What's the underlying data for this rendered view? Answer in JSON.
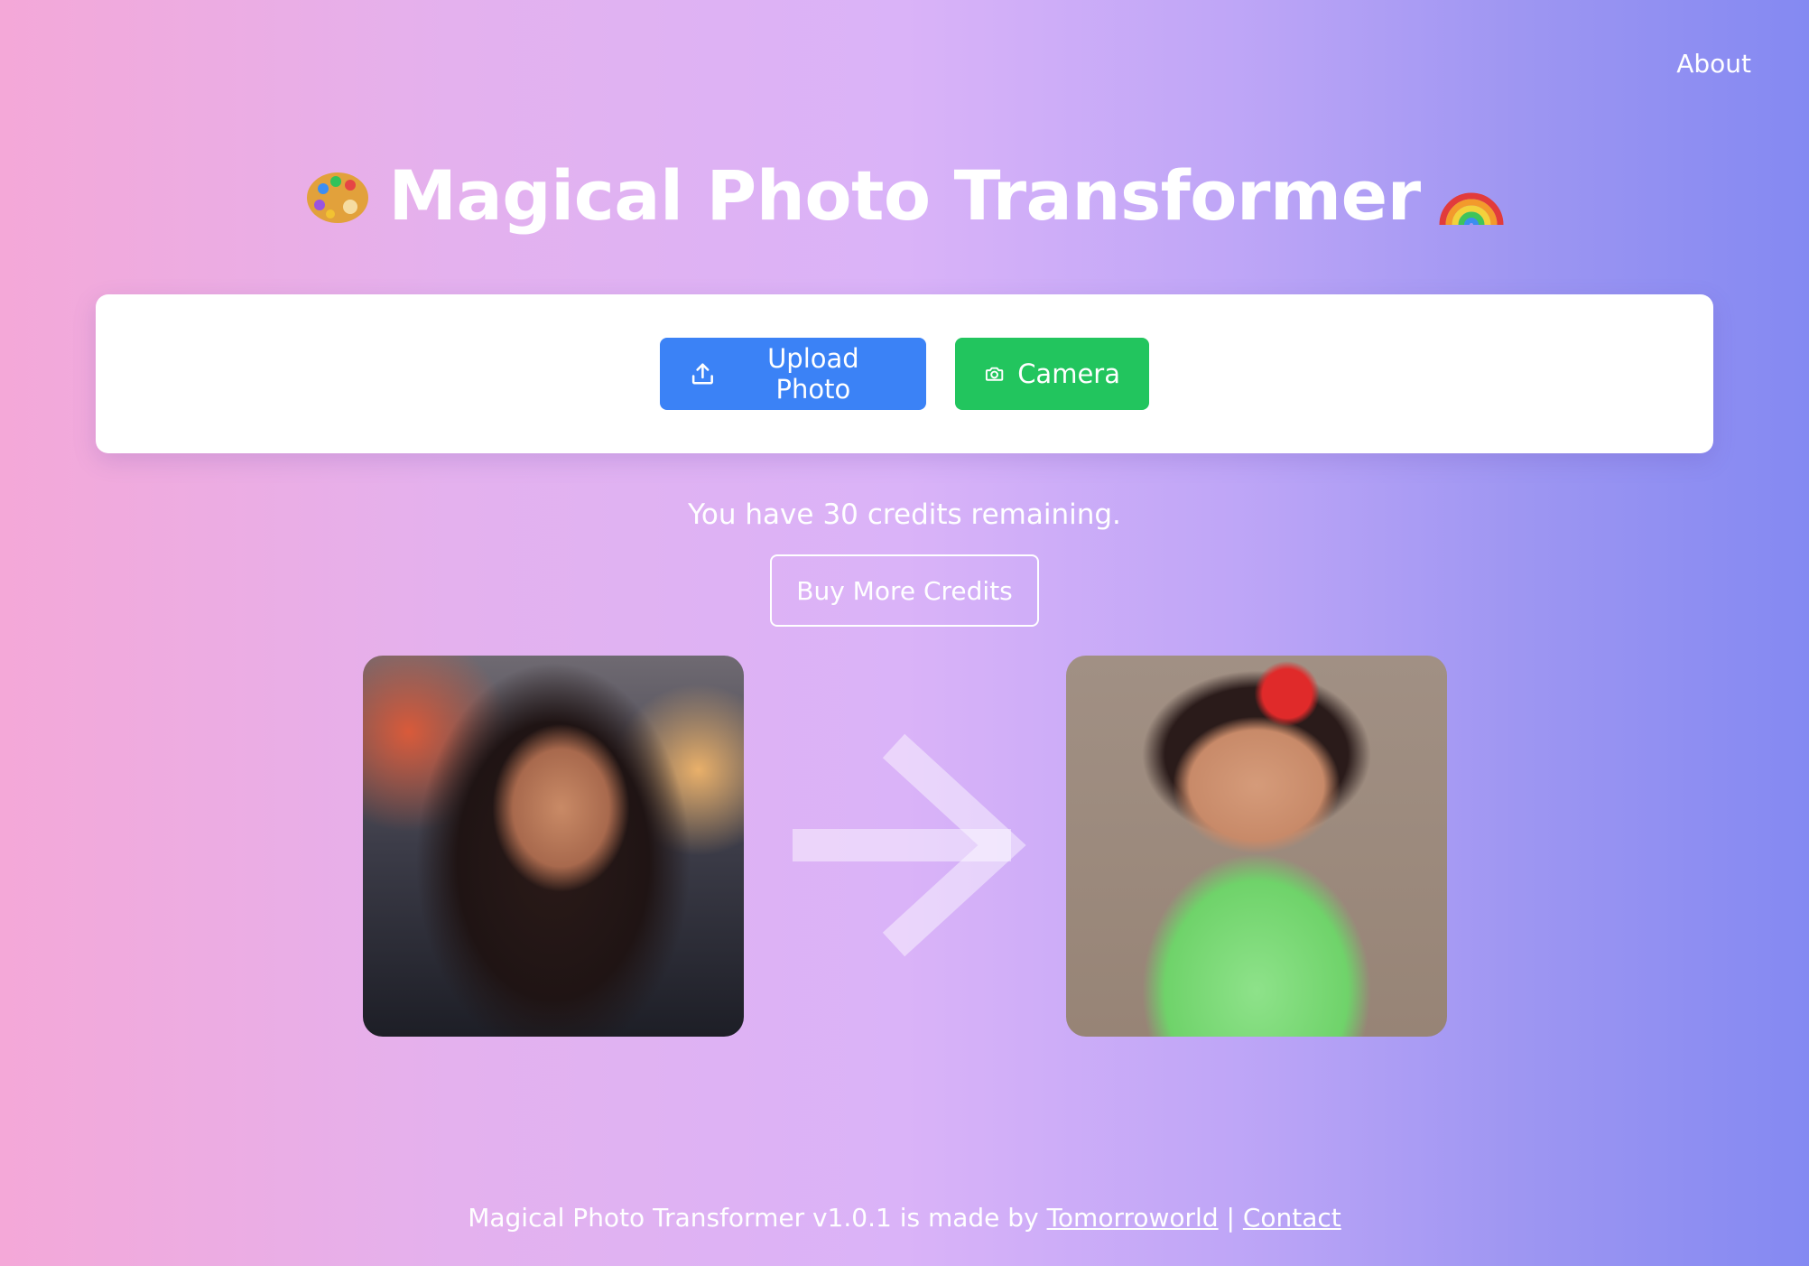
{
  "nav": {
    "about_label": "About"
  },
  "header": {
    "title": "Magical Photo Transformer",
    "left_emoji_icon": "artist-palette",
    "right_emoji_icon": "rainbow"
  },
  "actions": {
    "upload_label": "Upload Photo",
    "upload_icon": "upload-icon",
    "camera_label": "Camera",
    "camera_icon": "camera-icon",
    "upload_color": "#3b82f6",
    "camera_color": "#22c55e"
  },
  "credits": {
    "prefix": "You have",
    "count": "30",
    "suffix": "credits remaining.",
    "buy_label": "Buy More Credits"
  },
  "showcase": {
    "before_alt": "Portrait of a young woman",
    "after_alt": "Cartoon-style little girl in green polka-dot dress",
    "arrow_icon": "arrow-right-icon"
  },
  "footer": {
    "text": "Magical Photo Transformer v1.0.1 is made by",
    "author_link": "Tomorroworld",
    "separator": "|",
    "contact_link": "Contact"
  }
}
